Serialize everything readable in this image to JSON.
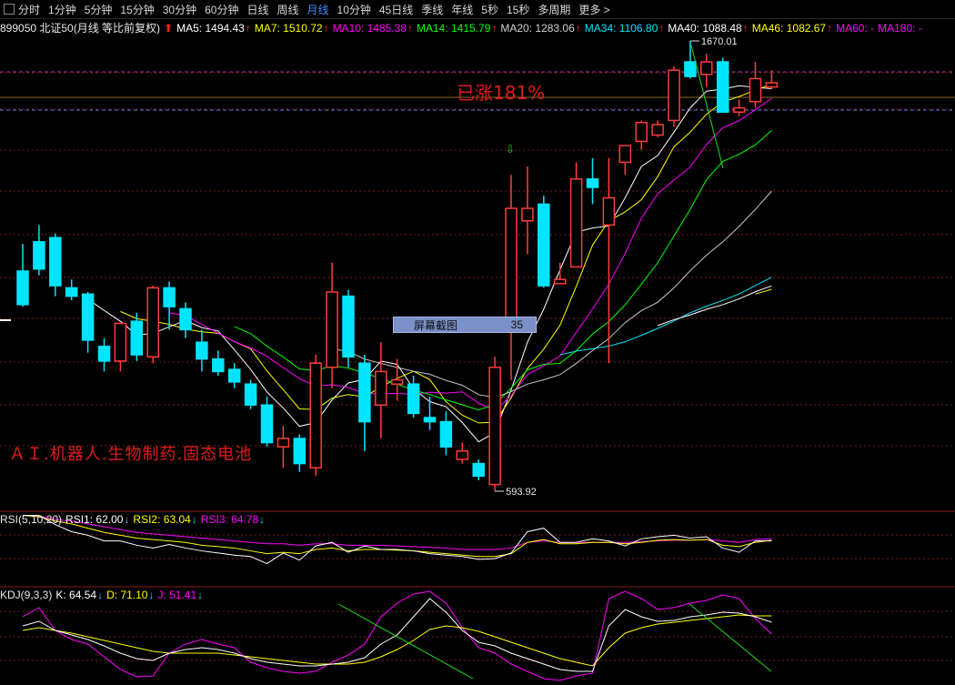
{
  "toolbar": {
    "tabs": [
      "分时",
      "1分钟",
      "5分钟",
      "15分钟",
      "30分钟",
      "60分钟",
      "日线",
      "周线",
      "月线",
      "10分钟",
      "45日线",
      "季线",
      "年线",
      "5秒",
      "15秒",
      "多周期",
      "更多 >"
    ],
    "active_tab": "月线"
  },
  "infobar": {
    "title": "899050 北证50(月线 等比前复权)",
    "ma": [
      {
        "label": "MA5: 1494.43",
        "color": "#ffffff",
        "arrow": "↑"
      },
      {
        "label": "MA7: 1510.72",
        "color": "#ffff00",
        "arrow": "↑"
      },
      {
        "label": "MA10: 1485.38",
        "color": "#ff00ff",
        "arrow": "↑"
      },
      {
        "label": "MA14: 1415.79",
        "color": "#00ff00",
        "arrow": "↑"
      },
      {
        "label": "MA20: 1283.06",
        "color": "#d0d0d0",
        "arrow": "↑"
      },
      {
        "label": "MA34: 1106.80",
        "color": "#00e5ff",
        "arrow": "↑"
      },
      {
        "label": "MA40: 1088.48",
        "color": "#ffffff",
        "arrow": "↑"
      },
      {
        "label": "MA46: 1082.67",
        "color": "#ffff00",
        "arrow": "↑"
      },
      {
        "label": "MA60: -",
        "color": "#ff00ff",
        "arrow": ""
      },
      {
        "label": "MA180: -",
        "color": "#ff00ff",
        "arrow": ""
      }
    ]
  },
  "annotations": {
    "high": "1670.01",
    "low": "593.92",
    "gain": "已涨181%",
    "theme": "ＡＩ.机器人.生物制药.固态电池",
    "screenshot_label": "屏幕截图",
    "screenshot_value": "35",
    "buy_marker": "⇩"
  },
  "rsi": {
    "title": "RSI(5,10,20)",
    "values": [
      {
        "label": "RSI1: 62.00",
        "color": "#ffffff",
        "arrow": "↓"
      },
      {
        "label": "RSI2: 63.04",
        "color": "#ffff00",
        "arrow": "↓"
      },
      {
        "label": "RSI3: 64.78",
        "color": "#ff00ff",
        "arrow": "↓"
      }
    ]
  },
  "kdj": {
    "title": "KDJ(9,3,3)",
    "values": [
      {
        "label": "K: 64.54",
        "color": "#ffffff",
        "arrow": "↓"
      },
      {
        "label": "D: 71.10",
        "color": "#ffff00",
        "arrow": "↓"
      },
      {
        "label": "J: 51.41",
        "color": "#ff00ff",
        "arrow": "↓"
      }
    ]
  },
  "colors": {
    "up": "#ff3b3b",
    "down": "#00e5ff",
    "grid": "#7a1a1a",
    "ref_line": "#b030b0"
  },
  "chart_data": {
    "type": "candlestick",
    "note_units": "price index points",
    "candles": [
      {
        "o": 1120,
        "h": 1185,
        "l": 1035,
        "c": 1040
      },
      {
        "o": 1190,
        "h": 1230,
        "l": 1110,
        "c": 1125
      },
      {
        "o": 1200,
        "h": 1210,
        "l": 1060,
        "c": 1085
      },
      {
        "o": 1080,
        "h": 1100,
        "l": 1050,
        "c": 1060
      },
      {
        "o": 1065,
        "h": 1070,
        "l": 925,
        "c": 955
      },
      {
        "o": 940,
        "h": 960,
        "l": 880,
        "c": 905
      },
      {
        "o": 905,
        "h": 935,
        "l": 880,
        "c": 995
      },
      {
        "o": 1000,
        "h": 1020,
        "l": 905,
        "c": 920
      },
      {
        "o": 915,
        "h": 1085,
        "l": 900,
        "c": 1080
      },
      {
        "o": 1080,
        "h": 1095,
        "l": 980,
        "c": 1035
      },
      {
        "o": 1030,
        "h": 1045,
        "l": 960,
        "c": 980
      },
      {
        "o": 950,
        "h": 980,
        "l": 880,
        "c": 910
      },
      {
        "o": 910,
        "h": 930,
        "l": 870,
        "c": 880
      },
      {
        "o": 885,
        "h": 900,
        "l": 840,
        "c": 855
      },
      {
        "o": 850,
        "h": 860,
        "l": 790,
        "c": 800
      },
      {
        "o": 800,
        "h": 820,
        "l": 700,
        "c": 710
      },
      {
        "o": 700,
        "h": 750,
        "l": 650,
        "c": 720
      },
      {
        "o": 720,
        "h": 730,
        "l": 640,
        "c": 660
      },
      {
        "o": 650,
        "h": 920,
        "l": 630,
        "c": 900
      },
      {
        "o": 890,
        "h": 1140,
        "l": 840,
        "c": 1070
      },
      {
        "o": 1060,
        "h": 1075,
        "l": 890,
        "c": 915
      },
      {
        "o": 900,
        "h": 920,
        "l": 690,
        "c": 760
      },
      {
        "o": 800,
        "h": 950,
        "l": 720,
        "c": 880
      },
      {
        "o": 850,
        "h": 910,
        "l": 810,
        "c": 860
      },
      {
        "o": 850,
        "h": 870,
        "l": 770,
        "c": 780
      },
      {
        "o": 770,
        "h": 820,
        "l": 740,
        "c": 760
      },
      {
        "o": 760,
        "h": 785,
        "l": 680,
        "c": 700
      },
      {
        "o": 670,
        "h": 710,
        "l": 660,
        "c": 690
      },
      {
        "o": 660,
        "h": 670,
        "l": 620,
        "c": 630
      },
      {
        "o": 610,
        "h": 915,
        "l": 593.92,
        "c": 890
      },
      {
        "o": 980,
        "h": 1350,
        "l": 860,
        "c": 1270
      },
      {
        "o": 1240,
        "h": 1370,
        "l": 1160,
        "c": 1270
      },
      {
        "o": 1280,
        "h": 1300,
        "l": 1080,
        "c": 1085
      },
      {
        "o": 1090,
        "h": 1140,
        "l": 1090,
        "c": 1100
      },
      {
        "o": 1130,
        "h": 1380,
        "l": 1130,
        "c": 1340
      },
      {
        "o": 1340,
        "h": 1390,
        "l": 1280,
        "c": 1320
      },
      {
        "o": 1230,
        "h": 1390,
        "l": 900,
        "c": 1295
      },
      {
        "o": 1380,
        "h": 1420,
        "l": 1350,
        "c": 1420
      },
      {
        "o": 1430,
        "h": 1480,
        "l": 1410,
        "c": 1475
      },
      {
        "o": 1445,
        "h": 1480,
        "l": 1440,
        "c": 1470
      },
      {
        "o": 1480,
        "h": 1610,
        "l": 1465,
        "c": 1600
      },
      {
        "o": 1620,
        "h": 1670.01,
        "l": 1580,
        "c": 1585
      },
      {
        "o": 1590,
        "h": 1640,
        "l": 1560,
        "c": 1620
      },
      {
        "o": 1620,
        "h": 1630,
        "l": 1500,
        "c": 1500
      },
      {
        "o": 1500,
        "h": 1530,
        "l": 1490,
        "c": 1510
      },
      {
        "o": 1525,
        "h": 1620,
        "l": 1510,
        "c": 1580
      },
      {
        "o": 1560,
        "h": 1600,
        "l": 1555,
        "c": 1570
      }
    ]
  }
}
